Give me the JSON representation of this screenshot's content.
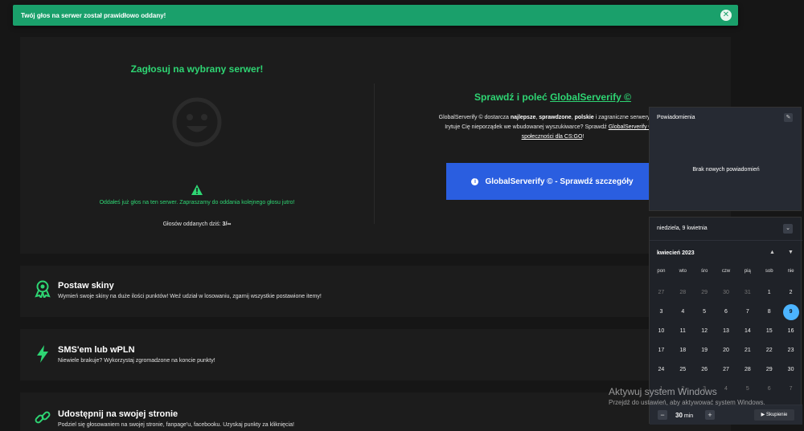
{
  "toast": {
    "message": "Twój głos na serwer został prawidłowo oddany!",
    "close_glyph": "✕"
  },
  "vote": {
    "title": "Zagłosuj na wybrany serwer!",
    "already_voted": "Oddałeś już głos na ten serwer. Zapraszamy do oddania kolejnego głosu jutro!",
    "count_label": "Głosów oddanych dziś: ",
    "count_value": "3/∞"
  },
  "promo": {
    "title_prefix": "Sprawdź i poleć ",
    "title_link": "GlobalServerify ©",
    "desc_1": "GlobalServerify © dostarcza ",
    "desc_bold_1": "najlepsze",
    "desc_2": ", ",
    "desc_bold_2": "sprawdzone",
    "desc_3": ", ",
    "desc_bold_3": "polskie",
    "desc_4": " i zagraniczne serwery bezpo",
    "desc_line2": "Irytuje Cię nieporządek we wbudowanej wyszukiwarce? Sprawdź ",
    "desc_link2": "GlobalServerify © - d",
    "desc_line3_link": "społeczności dla CS:GO",
    "desc_line3_end": "!",
    "button_label": "GlobalServerify © - Sprawdź szczegóły",
    "info_glyph": "i"
  },
  "features": [
    {
      "title": "Postaw skiny",
      "desc": "Wymień swoje skiny na duże ilości punktów! Weź udział w losowaniu, zgarnij wszystkie postawione itemy!",
      "icon": "award-icon"
    },
    {
      "title": "SMS'em lub wPLN",
      "desc": "Niewiele brakuje? Wykorzystaj zgromadzone na koncie punkty!",
      "icon": "lightning-icon"
    },
    {
      "title": "Udostępnij na swojej stronie",
      "desc": "Podziel się głosowaniem na swojej stronie, fanpage'u, facebooku. Uzyskaj punkty za kliknięcia!",
      "icon": "link-icon"
    }
  ],
  "notifications": {
    "title": "Powiadomienia",
    "empty": "Brak nowych powiadomień",
    "edit_glyph": "✎"
  },
  "calendar": {
    "full_date": "niedziela, 9 kwietnia",
    "collapse_glyph": "⌄",
    "month": "kwiecień 2023",
    "up_glyph": "▲",
    "down_glyph": "▼",
    "weekdays": [
      "pon",
      "wto",
      "śro",
      "czw",
      "pią",
      "sob",
      "nie"
    ],
    "days": [
      {
        "d": "27",
        "muted": true
      },
      {
        "d": "28",
        "muted": true
      },
      {
        "d": "29",
        "muted": true
      },
      {
        "d": "30",
        "muted": true
      },
      {
        "d": "31",
        "muted": true
      },
      {
        "d": "1"
      },
      {
        "d": "2"
      },
      {
        "d": "3"
      },
      {
        "d": "4"
      },
      {
        "d": "5"
      },
      {
        "d": "6"
      },
      {
        "d": "7"
      },
      {
        "d": "8"
      },
      {
        "d": "9",
        "today": true
      },
      {
        "d": "10"
      },
      {
        "d": "11"
      },
      {
        "d": "12"
      },
      {
        "d": "13"
      },
      {
        "d": "14"
      },
      {
        "d": "15"
      },
      {
        "d": "16"
      },
      {
        "d": "17"
      },
      {
        "d": "18"
      },
      {
        "d": "19"
      },
      {
        "d": "20"
      },
      {
        "d": "21"
      },
      {
        "d": "22"
      },
      {
        "d": "23"
      },
      {
        "d": "24"
      },
      {
        "d": "25"
      },
      {
        "d": "26"
      },
      {
        "d": "27"
      },
      {
        "d": "28"
      },
      {
        "d": "29"
      },
      {
        "d": "30"
      },
      {
        "d": "1",
        "muted": true
      },
      {
        "d": "2",
        "muted": true
      },
      {
        "d": "3",
        "muted": true
      },
      {
        "d": "4",
        "muted": true
      },
      {
        "d": "5",
        "muted": true
      },
      {
        "d": "6",
        "muted": true
      },
      {
        "d": "7",
        "muted": true
      }
    ],
    "focus_minus": "−",
    "focus_value": "30",
    "focus_unit": " min",
    "focus_plus": "+",
    "focus_button": "▶ Skupienie"
  },
  "watermark": {
    "line1": "Aktywuj system Windows",
    "line2": "Przejdź do ustawień, aby aktywować system Windows."
  },
  "colors": {
    "accent_green": "#2ed573",
    "toast_green": "#1aa06b",
    "button_blue": "#2a5ee0",
    "today_blue": "#4cb4ff"
  }
}
